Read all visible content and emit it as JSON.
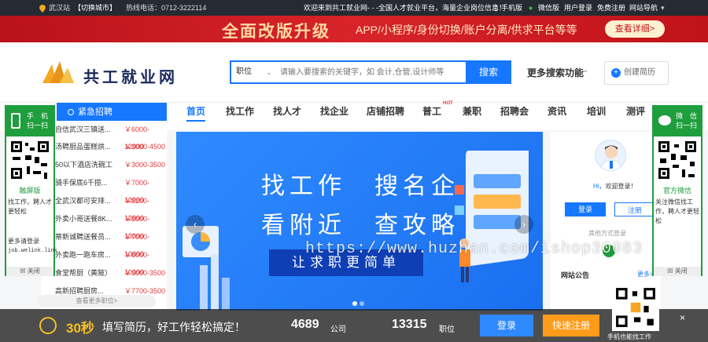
{
  "topbar": {
    "city": "武汉站",
    "switch_city": "【切换城市】",
    "hotline": "热线电话：0712-3222114",
    "welcome": "欢迎来到共工就业网- - -全国人才就业平台，海量企业岗位信息！",
    "mobile": "手机版",
    "wechat": "微信版",
    "user_login": "用户登录",
    "register": "免费注册",
    "site_nav": "网站导航"
  },
  "banner": {
    "title": "全面改版升级",
    "subtitle": "APP/小程序/身份切换/账户分离/供求平台等等",
    "button": "查看详细>"
  },
  "header": {
    "logo_text": "共工就业网",
    "search_type": "职位",
    "search_placeholder": "请输入要搜索的关键字，如 会计,仓管,设计师等",
    "search_button": "搜索",
    "more_search": "更多搜索功能",
    "create_resume": "创建简历"
  },
  "nav": {
    "urgent_label": "紧急招聘",
    "hot_badge": "HOT",
    "items": [
      "首页",
      "找工作",
      "找人才",
      "找企业",
      "店铺招聘",
      "普工",
      "兼职",
      "招聘会",
      "资讯",
      "培训",
      "测评"
    ]
  },
  "jobs": [
    {
      "title": "自信武汉三镇送...",
      "salary": "￥6000-12000"
    },
    {
      "title": "汤聘厨品蛋糕烘...",
      "salary": "￥3000-4500"
    },
    {
      "title": "50以下酒店洗碗工",
      "salary": "￥3000-3500"
    },
    {
      "title": "骑手保底6千揽...",
      "salary": "￥7000-12000"
    },
    {
      "title": "全武汉都可安排...",
      "salary": "￥8200-12000"
    },
    {
      "title": "外卖小哥送餐8K...",
      "salary": "￥8000-13000"
    },
    {
      "title": "蒂新诚聘送餐员...",
      "salary": "￥7000-10000"
    },
    {
      "title": "外卖跑一跑车房...",
      "salary": "￥8000-10000"
    },
    {
      "title": "食堂帮厨（黄陂）",
      "salary": "￥3000-3500"
    },
    {
      "title": "高新招聘厨房...",
      "salary": "￥7700-3500"
    }
  ],
  "joblist_more": "查看更多职位>",
  "hero": {
    "line1": "找工作　搜名企",
    "line2": "看附近　查攻略",
    "slogan": "让求职更简单"
  },
  "login_box": {
    "greeting_hi": "Hi，",
    "greeting": "欢迎登录！",
    "login": "登录",
    "register": "注册",
    "other_methods": "其他方式登录",
    "notice": "网站公告",
    "notice_more": "更多>"
  },
  "left_float": {
    "header": "手　机\n扫一扫",
    "caption": "触屏版",
    "desc": "找工作，聘人才更轻松",
    "extra": "更多请登录",
    "url": "job.welink.link",
    "close": "关闭"
  },
  "right_float": {
    "header": "微　信\n扫一扫",
    "caption": "官方微信",
    "desc": "关注微信找工作，聘人才更轻松",
    "close": "关闭"
  },
  "watermark": "https://www.huzhan.com/ishop30083",
  "bottom_bar": {
    "seconds": "30秒",
    "text": "填写简历，好工作轻松搞定！",
    "companies_count": "4689",
    "companies_unit": "公司",
    "jobs_count": "13315",
    "jobs_unit": "职位",
    "login": "登录",
    "register": "快速注册",
    "qr_caption": "手机也能找工作",
    "close": "×"
  },
  "colors": {
    "primary": "#1677ff",
    "green": "#1e9e3c",
    "red": "#e4393c",
    "banner_red": "#d8232a",
    "orange": "#ff9b1a"
  }
}
